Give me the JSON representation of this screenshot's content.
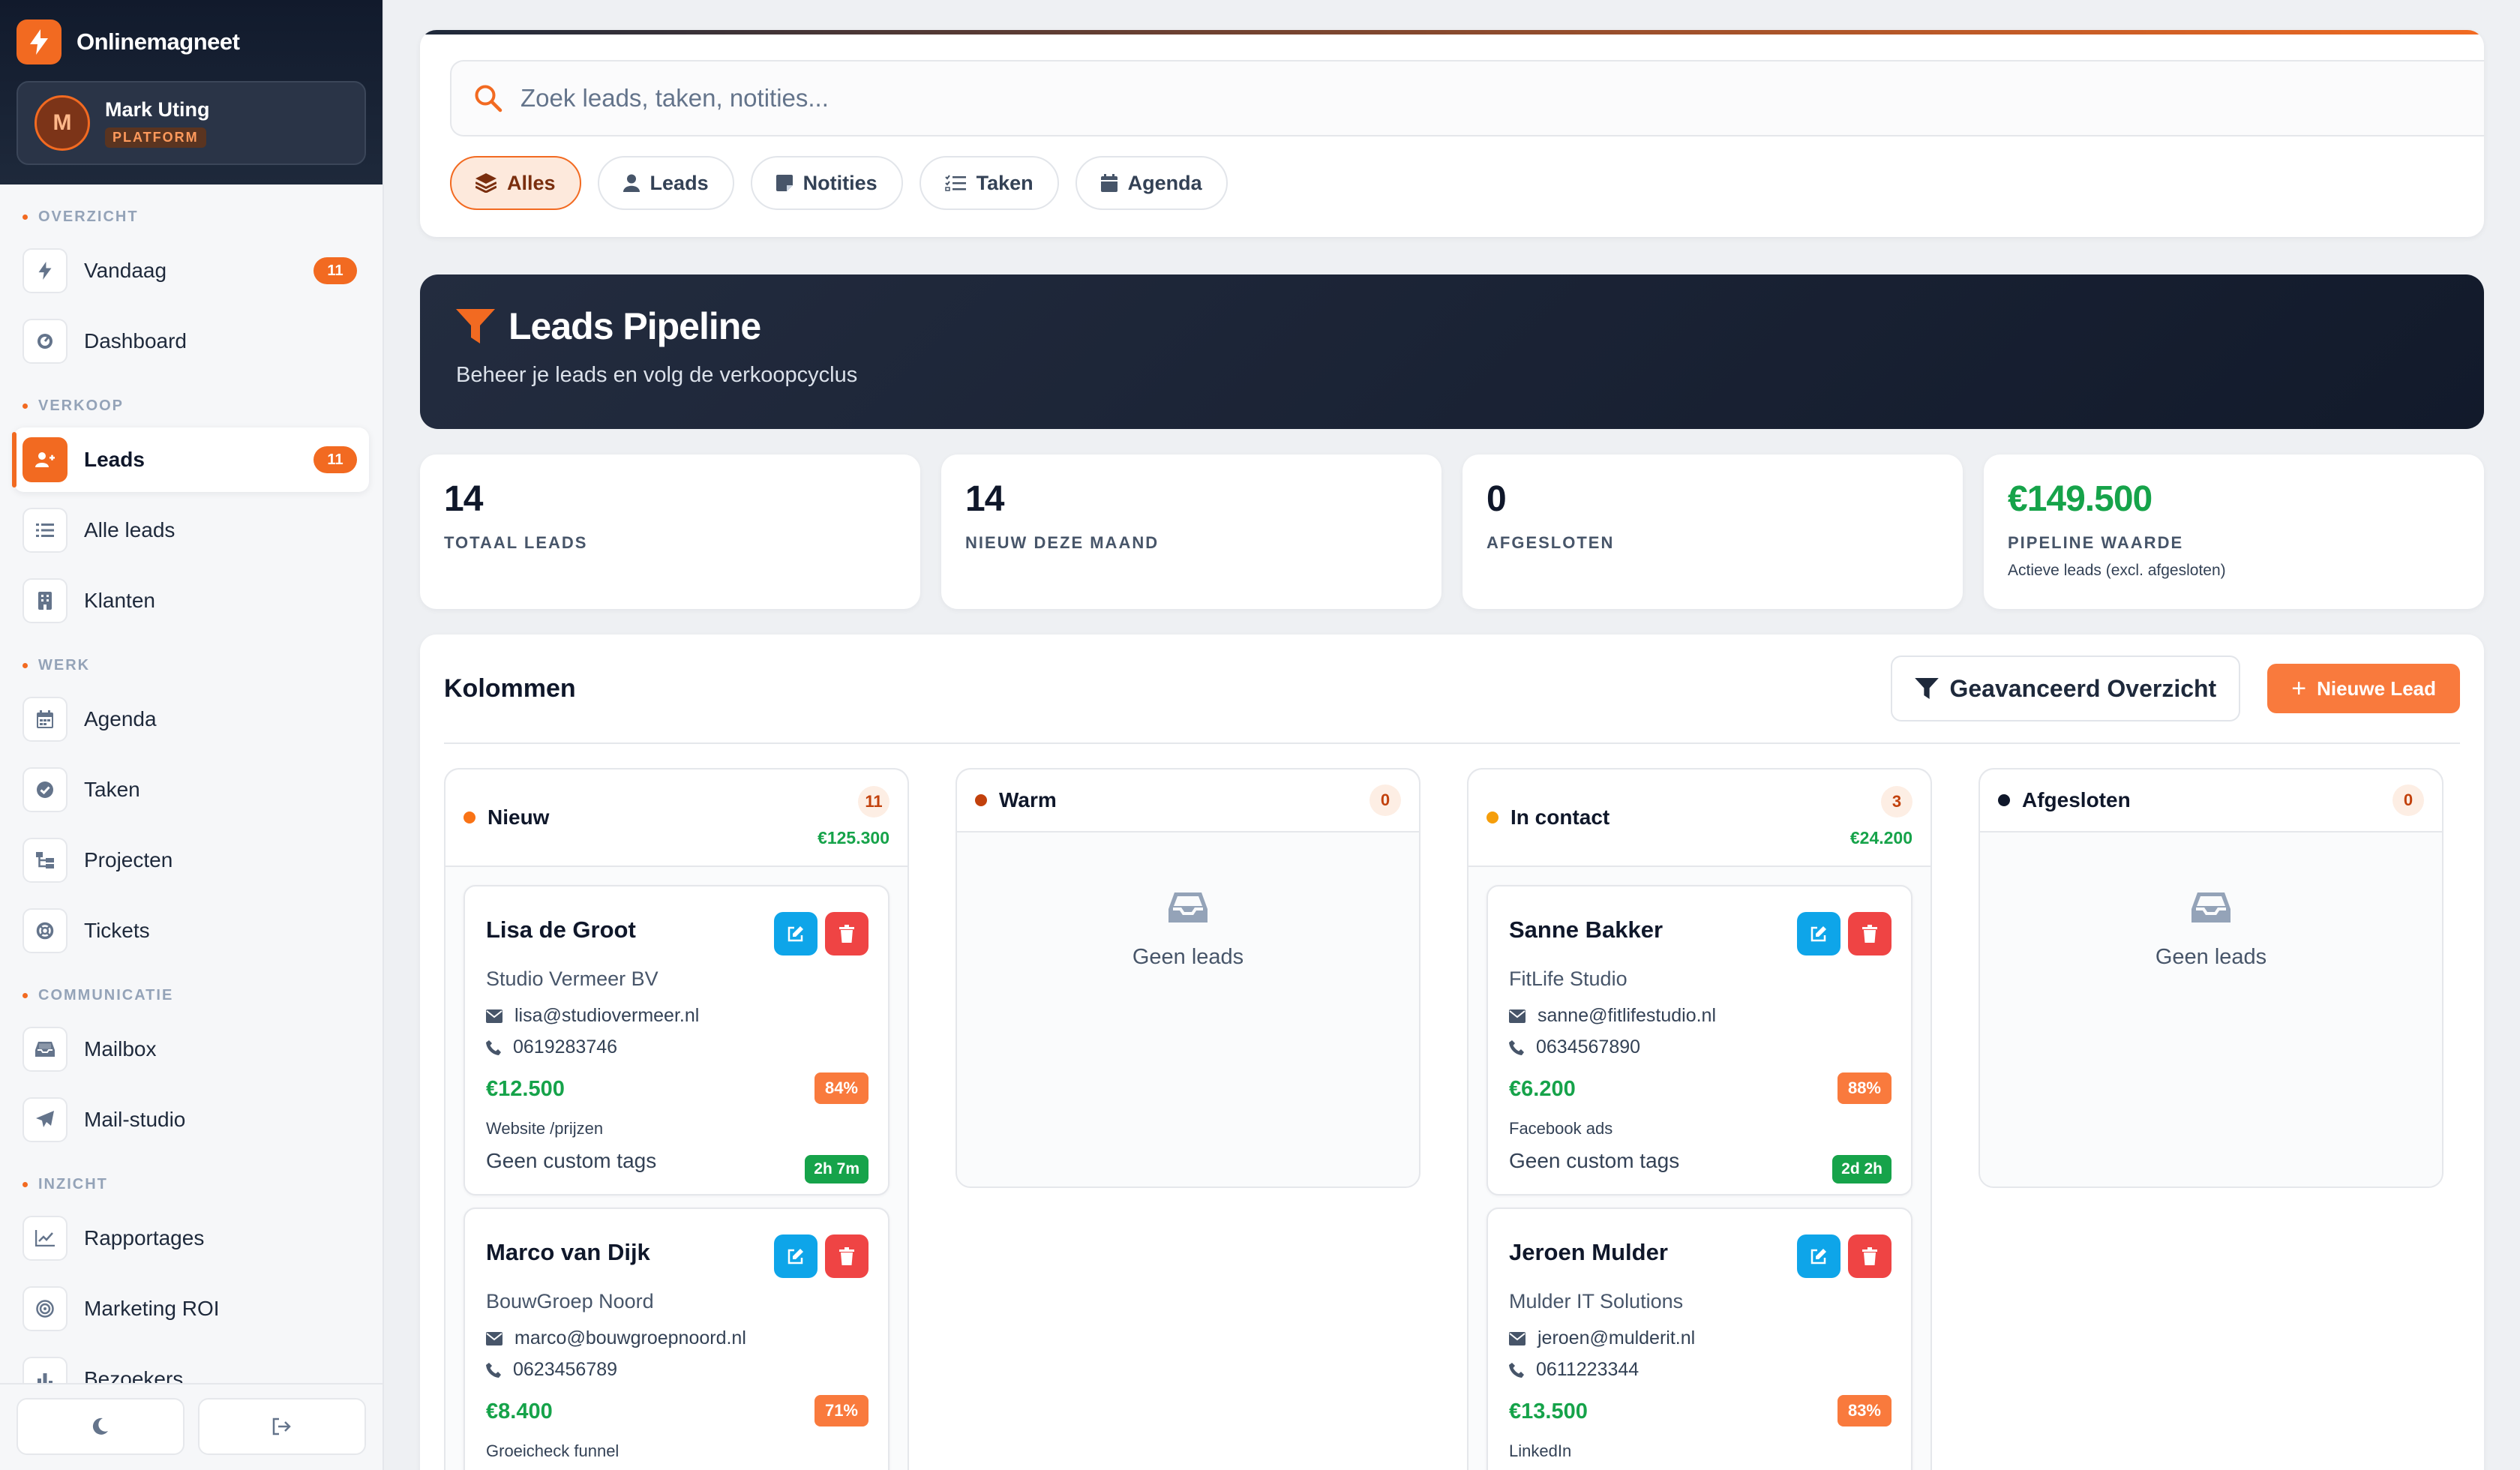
{
  "app": {
    "name": "Onlinemagneet"
  },
  "user": {
    "initial": "M",
    "name": "Mark Uting",
    "role": "PLATFORM"
  },
  "sidebar": {
    "sections": [
      {
        "title": "OVERZICHT",
        "items": [
          {
            "label": "Vandaag",
            "icon": "bolt-icon",
            "count": "11"
          },
          {
            "label": "Dashboard",
            "icon": "gauge-icon"
          }
        ]
      },
      {
        "title": "VERKOOP",
        "items": [
          {
            "label": "Leads",
            "icon": "user-plus-icon",
            "count": "11",
            "active": true
          },
          {
            "label": "Alle leads",
            "icon": "list-icon"
          },
          {
            "label": "Klanten",
            "icon": "building-icon"
          }
        ]
      },
      {
        "title": "WERK",
        "items": [
          {
            "label": "Agenda",
            "icon": "calendar-icon"
          },
          {
            "label": "Taken",
            "icon": "check-circle-icon"
          },
          {
            "label": "Projecten",
            "icon": "project-diagram-icon"
          },
          {
            "label": "Tickets",
            "icon": "life-ring-icon"
          }
        ]
      },
      {
        "title": "COMMUNICATIE",
        "items": [
          {
            "label": "Mailbox",
            "icon": "inbox-icon"
          },
          {
            "label": "Mail-studio",
            "icon": "paper-plane-icon"
          }
        ]
      },
      {
        "title": "INZICHT",
        "items": [
          {
            "label": "Rapportages",
            "icon": "chart-line-icon"
          },
          {
            "label": "Marketing ROI",
            "icon": "bullseye-icon"
          },
          {
            "label": "Bezoekers",
            "icon": "chart-bar-icon"
          }
        ]
      }
    ]
  },
  "search": {
    "placeholder": "Zoek leads, taken, notities..."
  },
  "filters": [
    {
      "label": "Alles",
      "icon": "layers-icon",
      "active": true
    },
    {
      "label": "Leads",
      "icon": "user-icon"
    },
    {
      "label": "Notities",
      "icon": "note-icon"
    },
    {
      "label": "Taken",
      "icon": "tasks-icon"
    },
    {
      "label": "Agenda",
      "icon": "calendar-icon"
    }
  ],
  "banner": {
    "title": "Leads Pipeline",
    "subtitle": "Beheer je leads en volg de verkoopcyclus"
  },
  "stats": [
    {
      "value": "14",
      "label": "TOTAAL LEADS"
    },
    {
      "value": "14",
      "label": "NIEUW DEZE MAAND"
    },
    {
      "value": "0",
      "label": "AFGESLOTEN"
    },
    {
      "value": "€149.500",
      "label": "PIPELINE WAARDE",
      "sub": "Actieve leads (excl. afgesloten)"
    }
  ],
  "board": {
    "title": "Kolommen",
    "advanced_label": "Geavanceerd Overzicht",
    "new_label": "Nieuwe Lead",
    "empty_label": "Geen leads"
  },
  "columns": [
    {
      "name": "Nieuw",
      "dot_color": "#f97316",
      "count": "11",
      "sum": "€125.300",
      "leads": [
        {
          "name": "Lisa de Groot",
          "company": "Studio Vermeer BV",
          "email": "lisa@studiovermeer.nl",
          "phone": "0619283746",
          "value": "€12.500",
          "score": "84%",
          "source": "Website /prijzen",
          "tags": "Geen custom tags",
          "age": "2h 7m"
        },
        {
          "name": "Marco van Dijk",
          "company": "BouwGroep Noord",
          "email": "marco@bouwgroepnoord.nl",
          "phone": "0623456789",
          "value": "€8.400",
          "score": "71%",
          "source": "Groeicheck funnel"
        }
      ]
    },
    {
      "name": "Warm",
      "dot_color": "#c2410c",
      "count": "0",
      "leads": []
    },
    {
      "name": "In contact",
      "dot_color": "#f59e0b",
      "count": "3",
      "sum": "€24.200",
      "leads": [
        {
          "name": "Sanne Bakker",
          "company": "FitLife Studio",
          "email": "sanne@fitlifestudio.nl",
          "phone": "0634567890",
          "value": "€6.200",
          "score": "88%",
          "source": "Facebook ads",
          "tags": "Geen custom tags",
          "age": "2d 2h"
        },
        {
          "name": "Jeroen Mulder",
          "company": "Mulder IT Solutions",
          "email": "jeroen@mulderit.nl",
          "phone": "0611223344",
          "value": "€13.500",
          "score": "83%",
          "source": "LinkedIn"
        }
      ]
    },
    {
      "name": "Afgesloten",
      "dot_color": "#0f172a",
      "count": "0",
      "leads": []
    }
  ],
  "colors": {
    "accent": "#f26a21",
    "positive": "#16a34a",
    "edit": "#0ea5e9",
    "delete": "#ef4444",
    "navy": "#1e293b"
  }
}
